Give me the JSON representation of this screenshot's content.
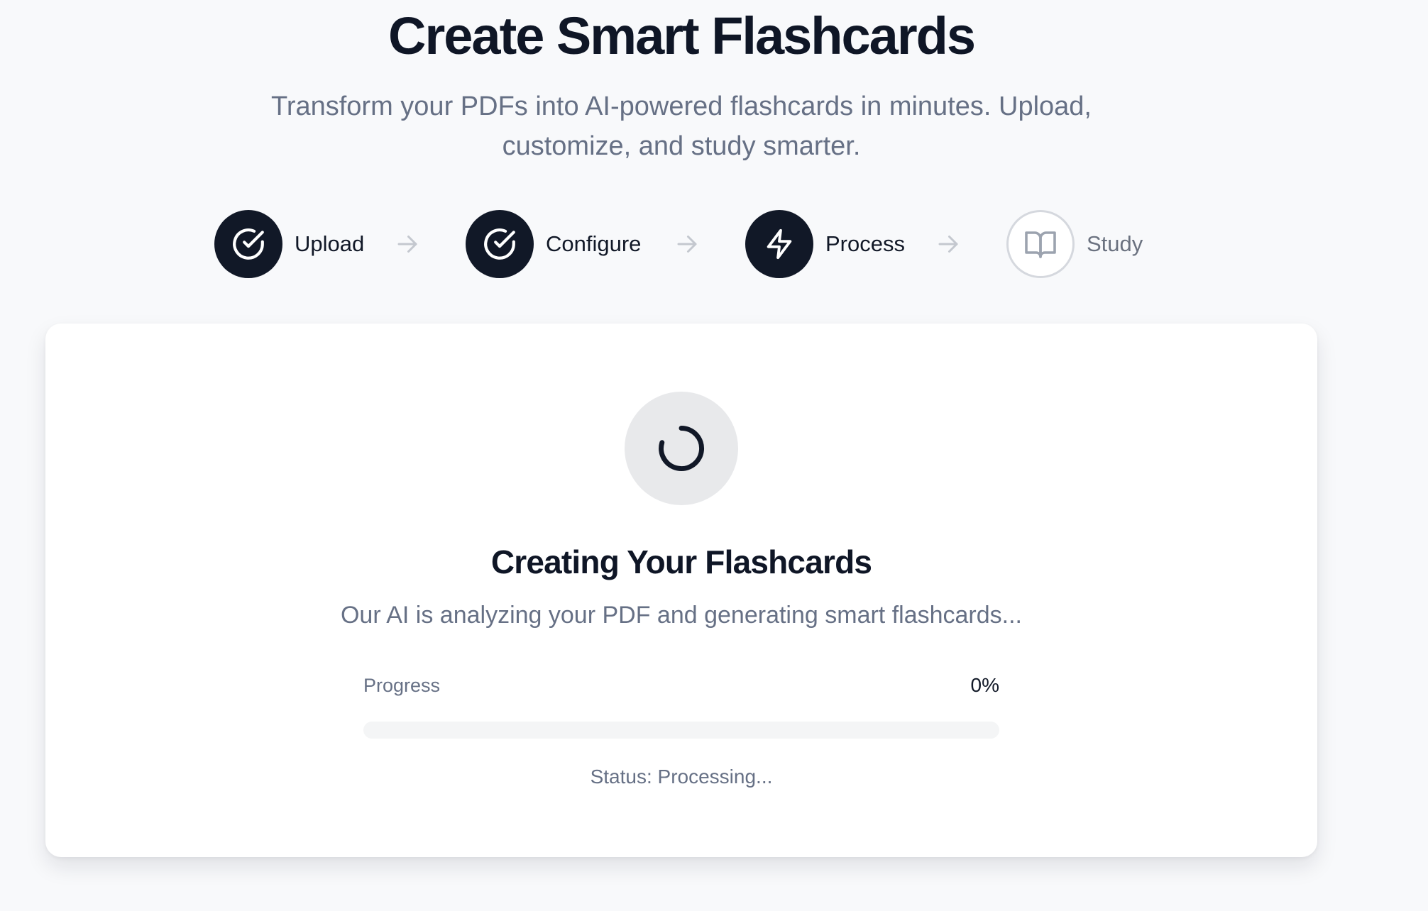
{
  "header": {
    "title": "Create Smart Flashcards",
    "subtitle": "Transform your PDFs into AI-powered flashcards in minutes. Upload, customize, and study smarter."
  },
  "steps": [
    {
      "label": "Upload",
      "icon": "check-circle-icon",
      "state": "complete"
    },
    {
      "label": "Configure",
      "icon": "check-circle-icon",
      "state": "complete"
    },
    {
      "label": "Process",
      "icon": "lightning-icon",
      "state": "active"
    },
    {
      "label": "Study",
      "icon": "book-open-icon",
      "state": "pending"
    }
  ],
  "processing_card": {
    "spinner_icon": "loading-spinner-icon",
    "title": "Creating Your Flashcards",
    "description": "Our AI is analyzing your PDF and generating smart flashcards...",
    "progress_label": "Progress",
    "progress_value": "0%",
    "progress_fraction": 0,
    "status": "Status: Processing..."
  },
  "colors": {
    "background": "#f8f9fb",
    "primary": "#111827",
    "muted_text": "#667085",
    "card": "#ffffff",
    "step_pending_border": "#d5d8de",
    "arrow": "#c4c8cf",
    "spinner_bg": "#e8e9eb",
    "progress_track": "#f4f5f6"
  }
}
